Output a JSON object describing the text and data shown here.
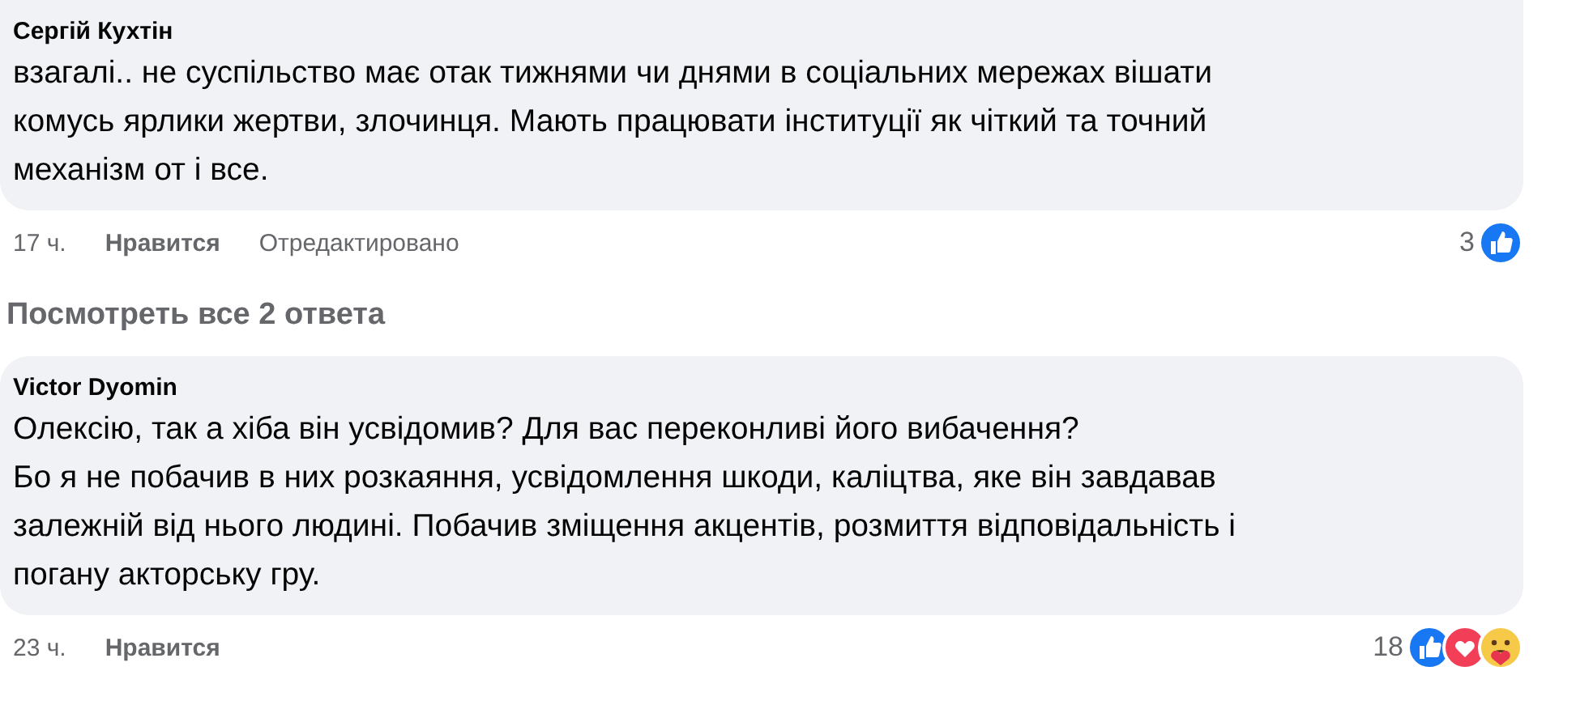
{
  "comments": [
    {
      "author": "Сергій Кухтін",
      "lines": [
        "взагалі.. не суспільство має отак тижнями чи днями в соціальних мережах вішати",
        "комусь ярлики жертви, злочинця. Мають працювати інституції як чіткий та точний",
        "механізм от і все."
      ],
      "time": "17 ч.",
      "like": "Нравится",
      "edited": "Отредактировано",
      "reaction_count": "3",
      "reactions": [
        {
          "kind": "like"
        }
      ]
    },
    {
      "replies_link": "Посмотреть все 2 ответа"
    },
    {
      "author": "Victor Dyomin",
      "lines": [
        "Олексію, так а хіба він усвідомив? Для вас переконливі його вибачення?",
        "Бо я не побачив в них розкаяння, усвідомлення шкоди, каліцтва, яке він завдавав",
        "залежній від нього людині. Побачив зміщення акцентів, розмиття відповідальність і",
        "погану акторську гру."
      ],
      "time": "23 ч.",
      "like": "Нравится",
      "reaction_count": "18",
      "reactions": [
        {
          "kind": "like"
        },
        {
          "kind": "love"
        },
        {
          "kind": "care"
        }
      ]
    }
  ]
}
